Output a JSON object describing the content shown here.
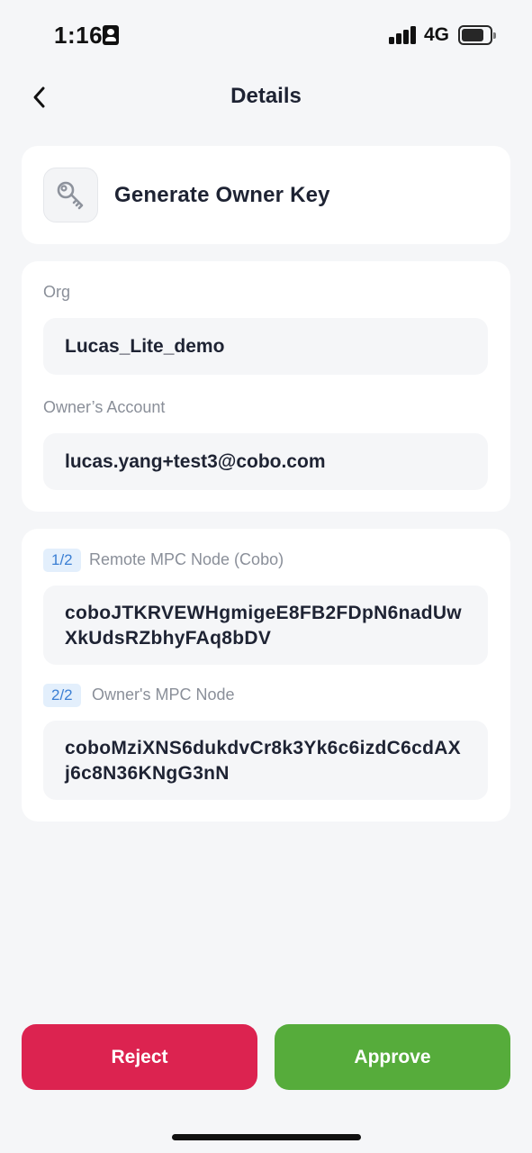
{
  "status_bar": {
    "time": "1:16",
    "network": "4G",
    "signal_bars": 4,
    "battery_level_percent": 75
  },
  "nav": {
    "title": "Details",
    "back_icon": "chevron-left-icon"
  },
  "header": {
    "icon": "key-icon",
    "title": "Generate Owner Key"
  },
  "info": {
    "org_label": "Org",
    "org_value": "Lucas_Lite_demo",
    "account_label": "Owner’s Account",
    "account_value": "lucas.yang+test3@cobo.com"
  },
  "mpc_nodes": [
    {
      "step": "1/2",
      "label": "Remote MPC Node (Cobo)",
      "value": "coboJTKRVEWHgmigeE8FB2FDpN6nadUwXkUdsRZbhyFAq8bDV"
    },
    {
      "step": "2/2",
      "label": "Owner's MPC Node",
      "value": "coboMziXNS6dukdvCr8k3Yk6c6izdC6cdAXj6c8N36KNgG3nN"
    }
  ],
  "actions": {
    "reject_label": "Reject",
    "approve_label": "Approve"
  },
  "colors": {
    "background": "#f5f6f8",
    "card": "#ffffff",
    "reject": "#dc2350",
    "approve": "#56ac3b",
    "badge_bg": "#e3effc",
    "badge_text": "#3b7fd4",
    "label_text": "#8a8f99",
    "value_text": "#1e2333"
  }
}
